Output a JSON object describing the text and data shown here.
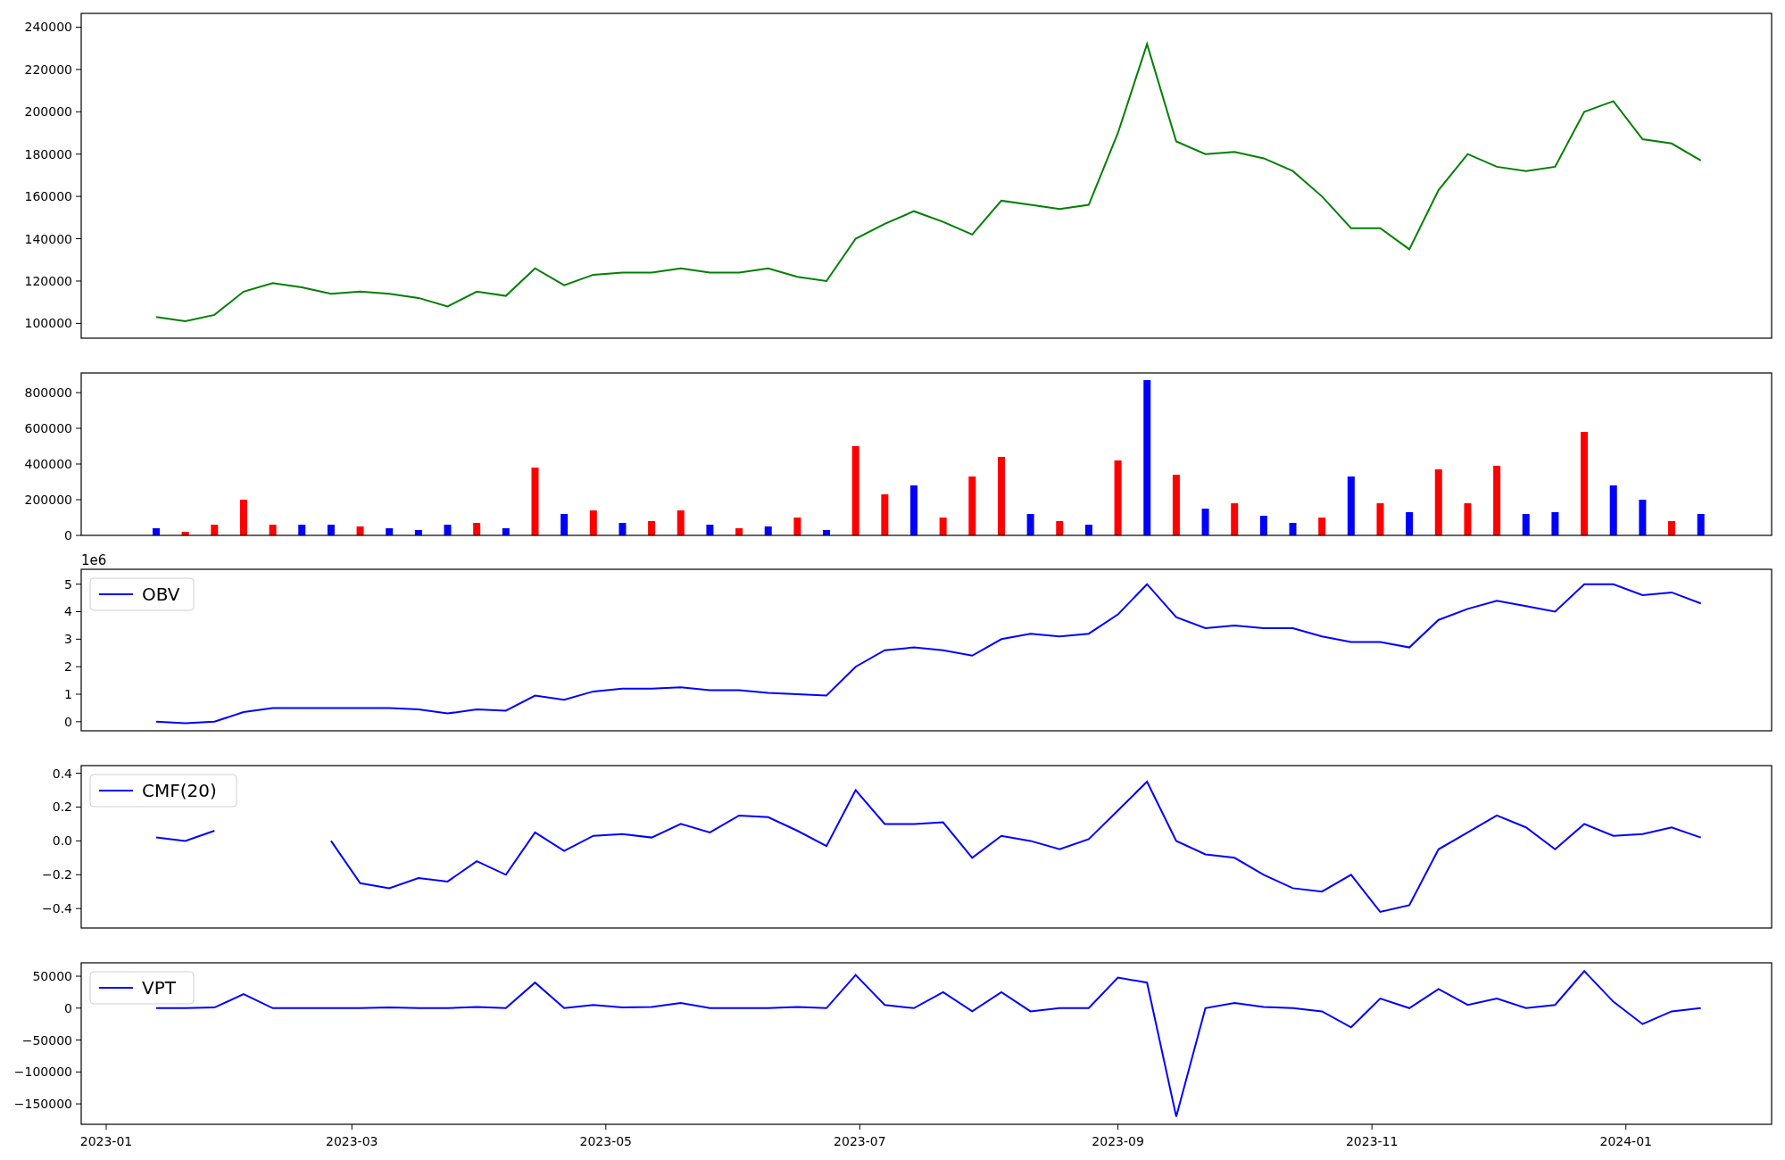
{
  "figure": {
    "panels": [
      {
        "chart_data": {
          "type": "line",
          "x": [
            "2023-01-13",
            "2023-01-20",
            "2023-01-27",
            "2023-02-03",
            "2023-02-10",
            "2023-02-17",
            "2023-02-24",
            "2023-03-03",
            "2023-03-10",
            "2023-03-17",
            "2023-03-24",
            "2023-03-31",
            "2023-04-07",
            "2023-04-14",
            "2023-04-21",
            "2023-04-28",
            "2023-05-05",
            "2023-05-12",
            "2023-05-19",
            "2023-05-26",
            "2023-06-02",
            "2023-06-09",
            "2023-06-16",
            "2023-06-23",
            "2023-06-30",
            "2023-07-07",
            "2023-07-14",
            "2023-07-21",
            "2023-07-28",
            "2023-08-04",
            "2023-08-11",
            "2023-08-18",
            "2023-08-25",
            "2023-09-01",
            "2023-09-08",
            "2023-09-15",
            "2023-09-22",
            "2023-09-29",
            "2023-10-06",
            "2023-10-13",
            "2023-10-20",
            "2023-10-27",
            "2023-11-03",
            "2023-11-10",
            "2023-11-17",
            "2023-11-24",
            "2023-12-01",
            "2023-12-08",
            "2023-12-15",
            "2023-12-22",
            "2023-12-29",
            "2024-01-05",
            "2024-01-12",
            "2024-01-19"
          ],
          "series": [
            {
              "color": "#008000",
              "values": [
                103000,
                101000,
                104000,
                115000,
                119000,
                117000,
                114000,
                115000,
                114000,
                112000,
                108000,
                115000,
                113000,
                126000,
                118000,
                123000,
                124000,
                124000,
                126000,
                124000,
                124000,
                126000,
                122000,
                120000,
                140000,
                147000,
                153000,
                148000,
                142000,
                158000,
                156000,
                154000,
                156000,
                190000,
                232000,
                186000,
                180000,
                181000,
                178000,
                172000,
                160000,
                145000,
                145000,
                135000,
                163000,
                180000,
                174000,
                172000,
                174000,
                200000,
                205000,
                187000,
                185000,
                177000
              ]
            }
          ],
          "xlim": [
            "2022-12-26",
            "2024-02-05"
          ],
          "ylim": [
            93000,
            246500
          ],
          "yticks": [
            100000,
            120000,
            140000,
            160000,
            180000,
            200000,
            220000,
            240000
          ]
        }
      },
      {
        "chart_data": {
          "type": "bar",
          "x": [
            "2023-01-13",
            "2023-01-20",
            "2023-01-27",
            "2023-02-03",
            "2023-02-10",
            "2023-02-17",
            "2023-02-24",
            "2023-03-03",
            "2023-03-10",
            "2023-03-17",
            "2023-03-24",
            "2023-03-31",
            "2023-04-07",
            "2023-04-14",
            "2023-04-21",
            "2023-04-28",
            "2023-05-05",
            "2023-05-12",
            "2023-05-19",
            "2023-05-26",
            "2023-06-02",
            "2023-06-09",
            "2023-06-16",
            "2023-06-23",
            "2023-06-30",
            "2023-07-07",
            "2023-07-14",
            "2023-07-21",
            "2023-07-28",
            "2023-08-04",
            "2023-08-11",
            "2023-08-18",
            "2023-08-25",
            "2023-09-01",
            "2023-09-08",
            "2023-09-15",
            "2023-09-22",
            "2023-09-29",
            "2023-10-06",
            "2023-10-13",
            "2023-10-20",
            "2023-10-27",
            "2023-11-03",
            "2023-11-10",
            "2023-11-17",
            "2023-11-24",
            "2023-12-01",
            "2023-12-08",
            "2023-12-15",
            "2023-12-22",
            "2023-12-29",
            "2024-01-05",
            "2024-01-12",
            "2024-01-19"
          ],
          "series": [
            {
              "color": "#0000ff",
              "values": [
                40000,
                null,
                null,
                null,
                null,
                60000,
                60000,
                null,
                40000,
                30000,
                60000,
                null,
                40000,
                null,
                120000,
                null,
                70000,
                null,
                null,
                60000,
                null,
                50000,
                null,
                30000,
                null,
                null,
                280000,
                null,
                null,
                null,
                120000,
                null,
                60000,
                null,
                870000,
                null,
                150000,
                null,
                110000,
                70000,
                null,
                330000,
                null,
                130000,
                null,
                null,
                null,
                120000,
                130000,
                null,
                280000,
                200000,
                null,
                120000
              ]
            },
            {
              "color": "#ff0000",
              "values": [
                null,
                20000,
                60000,
                200000,
                60000,
                null,
                null,
                50000,
                null,
                null,
                null,
                70000,
                null,
                380000,
                null,
                140000,
                null,
                80000,
                140000,
                null,
                40000,
                null,
                100000,
                null,
                500000,
                230000,
                null,
                100000,
                330000,
                440000,
                null,
                80000,
                null,
                420000,
                null,
                340000,
                null,
                180000,
                null,
                null,
                100000,
                null,
                180000,
                null,
                370000,
                180000,
                390000,
                null,
                null,
                580000,
                null,
                null,
                80000,
                null
              ]
            }
          ],
          "xlim": [
            "2022-12-26",
            "2024-02-05"
          ],
          "ylim": [
            0,
            910000
          ],
          "yticks": [
            0,
            200000,
            400000,
            600000,
            800000
          ]
        }
      },
      {
        "offset_label": "1e6",
        "chart_data": {
          "type": "line",
          "x": [
            "2023-01-13",
            "2023-01-20",
            "2023-01-27",
            "2023-02-03",
            "2023-02-10",
            "2023-02-17",
            "2023-02-24",
            "2023-03-03",
            "2023-03-10",
            "2023-03-17",
            "2023-03-24",
            "2023-03-31",
            "2023-04-07",
            "2023-04-14",
            "2023-04-21",
            "2023-04-28",
            "2023-05-05",
            "2023-05-12",
            "2023-05-19",
            "2023-05-26",
            "2023-06-02",
            "2023-06-09",
            "2023-06-16",
            "2023-06-23",
            "2023-06-30",
            "2023-07-07",
            "2023-07-14",
            "2023-07-21",
            "2023-07-28",
            "2023-08-04",
            "2023-08-11",
            "2023-08-18",
            "2023-08-25",
            "2023-09-01",
            "2023-09-08",
            "2023-09-15",
            "2023-09-22",
            "2023-09-29",
            "2023-10-06",
            "2023-10-13",
            "2023-10-20",
            "2023-10-27",
            "2023-11-03",
            "2023-11-10",
            "2023-11-17",
            "2023-11-24",
            "2023-12-01",
            "2023-12-08",
            "2023-12-15",
            "2023-12-22",
            "2023-12-29",
            "2024-01-05",
            "2024-01-12",
            "2024-01-19"
          ],
          "series": [
            {
              "name": "OBV",
              "color": "#0000ff",
              "values": [
                0,
                -0.05,
                0,
                0.35,
                0.5,
                0.5,
                0.5,
                0.5,
                0.5,
                0.45,
                0.3,
                0.45,
                0.4,
                0.95,
                0.8,
                1.1,
                1.2,
                1.2,
                1.25,
                1.15,
                1.15,
                1.05,
                1.0,
                0.95,
                2.0,
                2.6,
                2.7,
                2.6,
                2.4,
                3.0,
                3.2,
                3.1,
                3.2,
                3.9,
                5.0,
                3.8,
                3.4,
                3.5,
                3.4,
                3.4,
                3.1,
                2.9,
                2.9,
                2.7,
                3.7,
                4.1,
                4.4,
                4.2,
                4.0,
                5.0,
                5.0,
                4.6,
                4.7,
                4.3
              ]
            }
          ],
          "xlim": [
            "2022-12-26",
            "2024-02-05"
          ],
          "ylim": [
            -0.33,
            5.54
          ],
          "yticks": [
            0,
            1,
            2,
            3,
            4,
            5
          ]
        }
      },
      {
        "chart_data": {
          "type": "line",
          "x": [
            "2023-01-13",
            "2023-01-20",
            "2023-01-27",
            "2023-02-03",
            "2023-02-10",
            "2023-02-17",
            "2023-02-24",
            "2023-03-03",
            "2023-03-10",
            "2023-03-17",
            "2023-03-24",
            "2023-03-31",
            "2023-04-07",
            "2023-04-14",
            "2023-04-21",
            "2023-04-28",
            "2023-05-05",
            "2023-05-12",
            "2023-05-19",
            "2023-05-26",
            "2023-06-02",
            "2023-06-09",
            "2023-06-16",
            "2023-06-23",
            "2023-06-30",
            "2023-07-07",
            "2023-07-14",
            "2023-07-21",
            "2023-07-28",
            "2023-08-04",
            "2023-08-11",
            "2023-08-18",
            "2023-08-25",
            "2023-09-01",
            "2023-09-08",
            "2023-09-15",
            "2023-09-22",
            "2023-09-29",
            "2023-10-06",
            "2023-10-13",
            "2023-10-20",
            "2023-10-27",
            "2023-11-03",
            "2023-11-10",
            "2023-11-17",
            "2023-11-24",
            "2023-12-01",
            "2023-12-08",
            "2023-12-15",
            "2023-12-22",
            "2023-12-29",
            "2024-01-05",
            "2024-01-12",
            "2024-01-19"
          ],
          "series": [
            {
              "name": "CMF(20)",
              "color": "#0000ff",
              "values": [
                0.02,
                0.0,
                0.06,
                null,
                null,
                null,
                0.0,
                -0.25,
                -0.28,
                -0.22,
                -0.24,
                -0.12,
                -0.2,
                0.05,
                -0.06,
                0.03,
                0.04,
                0.02,
                0.1,
                0.05,
                0.15,
                0.14,
                0.06,
                -0.03,
                0.3,
                0.1,
                0.1,
                0.11,
                -0.1,
                0.03,
                0.0,
                -0.05,
                0.01,
                0.18,
                0.35,
                0.0,
                -0.08,
                -0.1,
                -0.2,
                -0.28,
                -0.3,
                -0.2,
                -0.42,
                -0.38,
                -0.05,
                0.05,
                0.15,
                0.08,
                -0.05,
                0.1,
                0.03,
                0.04,
                0.08,
                0.02
              ]
            }
          ],
          "xlim": [
            "2022-12-26",
            "2024-02-05"
          ],
          "ylim": [
            -0.515,
            0.445
          ],
          "yticks": [
            {
              "value": -0.4,
              "label": "−0.4"
            },
            {
              "value": -0.2,
              "label": "−0.2"
            },
            {
              "value": 0,
              "label": "0.0"
            },
            {
              "value": 0.2,
              "label": "0.2"
            },
            {
              "value": 0.4,
              "label": "0.4"
            }
          ]
        }
      },
      {
        "chart_data": {
          "type": "line",
          "x": [
            "2023-01-13",
            "2023-01-20",
            "2023-01-27",
            "2023-02-03",
            "2023-02-10",
            "2023-02-17",
            "2023-02-24",
            "2023-03-03",
            "2023-03-10",
            "2023-03-17",
            "2023-03-24",
            "2023-03-31",
            "2023-04-07",
            "2023-04-14",
            "2023-04-21",
            "2023-04-28",
            "2023-05-05",
            "2023-05-12",
            "2023-05-19",
            "2023-05-26",
            "2023-06-02",
            "2023-06-09",
            "2023-06-16",
            "2023-06-23",
            "2023-06-30",
            "2023-07-07",
            "2023-07-14",
            "2023-07-21",
            "2023-07-28",
            "2023-08-04",
            "2023-08-11",
            "2023-08-18",
            "2023-08-25",
            "2023-09-01",
            "2023-09-08",
            "2023-09-15",
            "2023-09-22",
            "2023-09-29",
            "2023-10-06",
            "2023-10-13",
            "2023-10-20",
            "2023-10-27",
            "2023-11-03",
            "2023-11-10",
            "2023-11-17",
            "2023-11-24",
            "2023-12-01",
            "2023-12-08",
            "2023-12-15",
            "2023-12-22",
            "2023-12-29",
            "2024-01-05",
            "2024-01-12",
            "2024-01-19"
          ],
          "series": [
            {
              "name": "VPT",
              "color": "#0000ff",
              "values": [
                0,
                0,
                1000,
                22000,
                0,
                0,
                0,
                0,
                1000,
                0,
                0,
                2000,
                0,
                40000,
                0,
                5000,
                1000,
                2000,
                8000,
                0,
                0,
                0,
                2000,
                0,
                52000,
                5000,
                0,
                25000,
                -5000,
                25000,
                -5000,
                0,
                0,
                48000,
                40000,
                -170000,
                0,
                8000,
                2000,
                0,
                -5000,
                -30000,
                15000,
                0,
                30000,
                5000,
                15000,
                0,
                5000,
                58000,
                10000,
                -25000,
                -5000,
                0
              ]
            }
          ],
          "xlim": [
            "2022-12-26",
            "2024-02-05"
          ],
          "ylim": [
            -182000,
            71000
          ],
          "yticks": [
            {
              "value": -150000,
              "label": "−150000"
            },
            {
              "value": -100000,
              "label": "−100000"
            },
            {
              "value": -50000,
              "label": "−50000"
            },
            {
              "value": 0,
              "label": "0"
            },
            {
              "value": 50000,
              "label": "50000"
            }
          ],
          "xticks": [
            {
              "value": "2023-01-01",
              "label": "2023-01"
            },
            {
              "value": "2023-03-01",
              "label": "2023-03"
            },
            {
              "value": "2023-05-01",
              "label": "2023-05"
            },
            {
              "value": "2023-07-01",
              "label": "2023-07"
            },
            {
              "value": "2023-09-01",
              "label": "2023-09"
            },
            {
              "value": "2023-11-01",
              "label": "2023-11"
            },
            {
              "value": "2024-01-01",
              "label": "2024-01"
            }
          ]
        }
      }
    ]
  }
}
